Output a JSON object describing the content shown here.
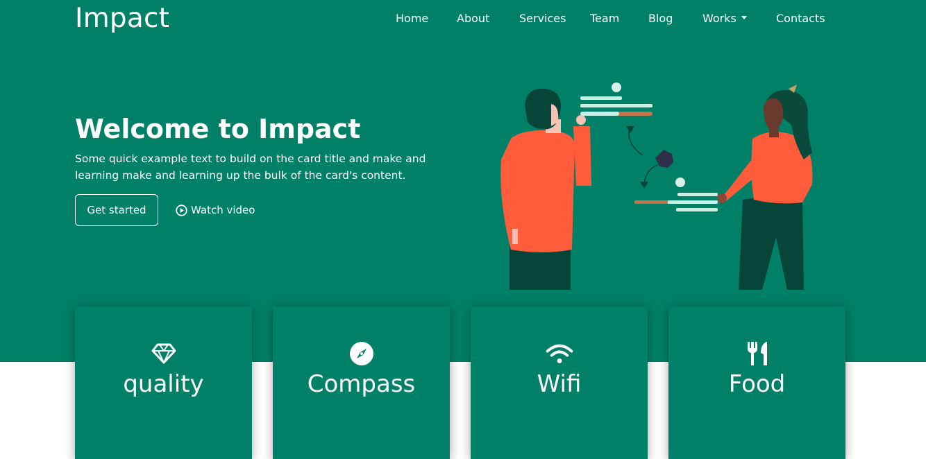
{
  "header": {
    "brand": "Impact",
    "nav": [
      {
        "label": "Home"
      },
      {
        "label": "About"
      },
      {
        "label": "Services"
      },
      {
        "label": "Team"
      },
      {
        "label": "Blog"
      },
      {
        "label": "Works",
        "has_dropdown": true
      },
      {
        "label": "Contacts"
      }
    ]
  },
  "hero": {
    "title": "Welcome to Impact",
    "text": "Some quick example text to build on the card title and make and learning make and learning up the bulk of the card's content.",
    "primary_button": "Get started",
    "video_button": "Watch video",
    "video_icon": "play-circle-icon"
  },
  "cards": [
    {
      "title": "quality",
      "icon": "diamond-icon"
    },
    {
      "title": "Compass",
      "icon": "compass-icon"
    },
    {
      "title": "Wifi",
      "icon": "wifi-icon"
    },
    {
      "title": "Food",
      "icon": "cutlery-icon"
    }
  ],
  "colors": {
    "primary": "#008066",
    "text": "#ffffff",
    "illustration_orange": "#ff5c3c",
    "illustration_dark": "#064537"
  }
}
